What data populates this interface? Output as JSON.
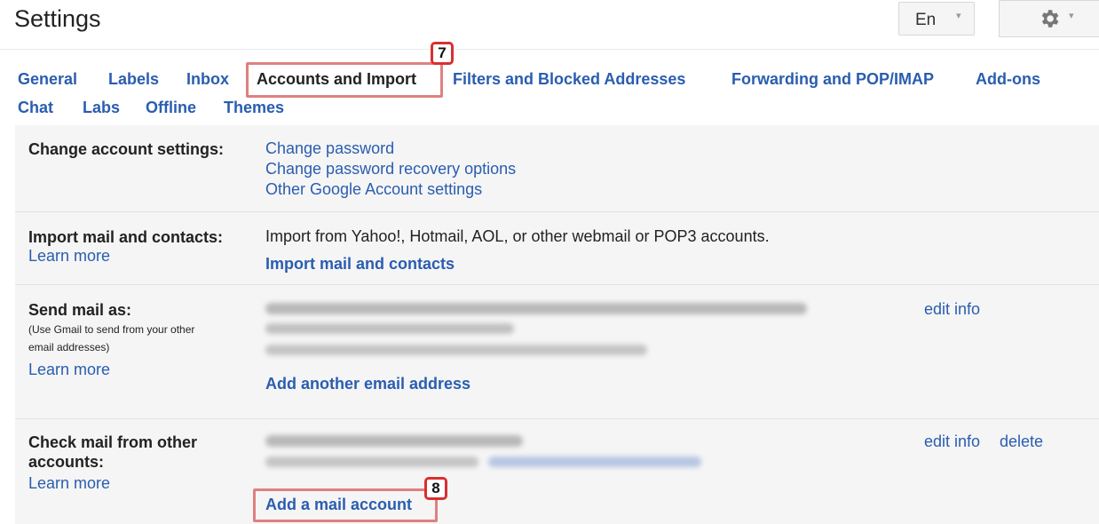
{
  "header": {
    "title": "Settings",
    "language_button": "En",
    "language_caret": "▾",
    "settings_caret": "▾",
    "settings_icon": "gear-icon"
  },
  "tabs": {
    "general": "General",
    "labels": "Labels",
    "inbox": "Inbox",
    "accounts": "Accounts and Import",
    "filters": "Filters and Blocked Addresses",
    "forwarding": "Forwarding and POP/IMAP",
    "addons": "Add-ons",
    "chat": "Chat",
    "labs": "Labs",
    "offline": "Offline",
    "themes": "Themes"
  },
  "annotations": {
    "step7": "7",
    "step8": "8",
    "highlight_color": "#e08080",
    "badge_border_color": "#d83030"
  },
  "account_settings": {
    "label": "Change account settings:",
    "links": [
      "Change password",
      "Change password recovery options",
      "Other Google Account settings"
    ]
  },
  "import": {
    "label": "Import mail and contacts:",
    "learn_more": "Learn more",
    "description": "Import from Yahoo!, Hotmail, AOL, or other webmail or POP3 accounts.",
    "action": "Import mail and contacts"
  },
  "send_as": {
    "label": "Send mail as:",
    "note_line1": "(Use Gmail to send from your other",
    "note_line2": "email addresses)",
    "learn_more": "Learn more",
    "edit_info": "edit info",
    "add_action": "Add another email address"
  },
  "check_mail": {
    "label_line1": "Check mail from other",
    "label_line2": "accounts:",
    "learn_more": "Learn more",
    "edit_info": "edit info",
    "delete": "delete",
    "add_action": "Add a mail account"
  },
  "colors": {
    "link": "#2a5db0",
    "panel_bg": "#f5f5f5"
  }
}
